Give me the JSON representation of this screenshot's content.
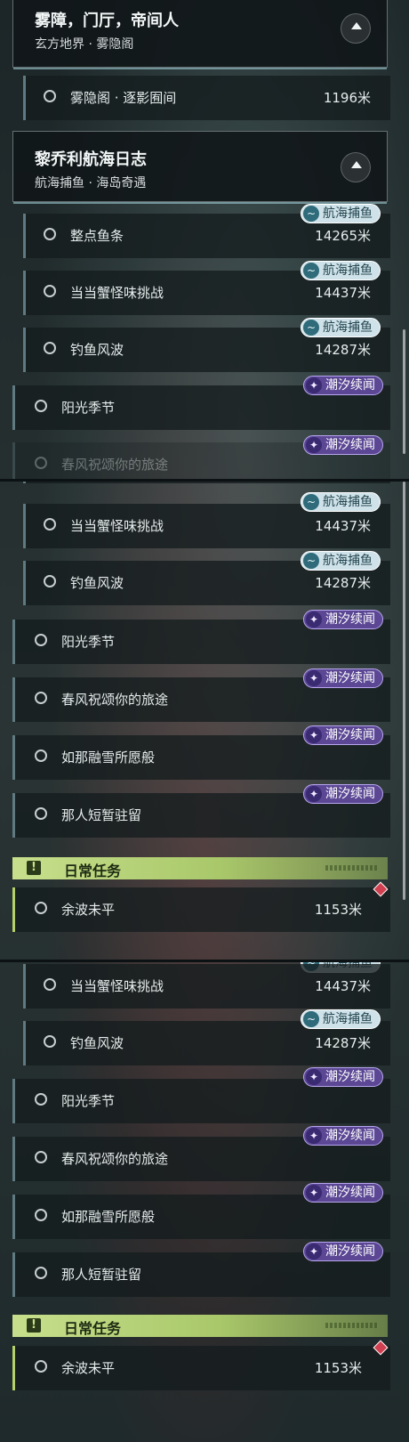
{
  "header_misty": {
    "title": "雾障，门厅，帝间人",
    "subtitle": "玄方地界 · 雾隐阁"
  },
  "header_logbook": {
    "title": "黎乔利航海日志",
    "subtitle": "航海捕鱼 · 海岛奇遇"
  },
  "quest_misty": {
    "label": "雾隐阁 · 逐影囿间",
    "distance": "1196米"
  },
  "quests": {
    "zhengdian": {
      "label": "整点鱼条",
      "distance": "14265米"
    },
    "dangdang": {
      "label": "当当蟹怪味挑战",
      "distance": "14437米"
    },
    "diaoyu": {
      "label": "钓鱼风波",
      "distance": "14287米"
    },
    "yangguang": {
      "label": "阳光季节"
    },
    "chunfeng": {
      "label": "春风祝颂你的旅途"
    },
    "rongxue": {
      "label": "如那融雪所愿般"
    },
    "naren": {
      "label": "那人短暂驻留"
    },
    "yubo": {
      "label": "余波未平",
      "distance": "1153米"
    }
  },
  "partial_label": "春风祝颂你的旅途",
  "badges": {
    "voyage": "航海捕鱼",
    "tide": "潮汐续闻"
  },
  "daily": {
    "title": "日常任务"
  },
  "icons": {
    "expand": "collapse-arrow-icon",
    "quest_status": "circle-icon",
    "daily": "exclamation-icon",
    "voyage": "fish-wave-icon",
    "tide": "feather-icon",
    "marker": "diamond-marker-icon"
  },
  "colors": {
    "daily_bar": "#c7df8c",
    "tide_badge": "#5b4794",
    "voyage_badge": "#cfe2ea",
    "marker": "#d04050"
  }
}
